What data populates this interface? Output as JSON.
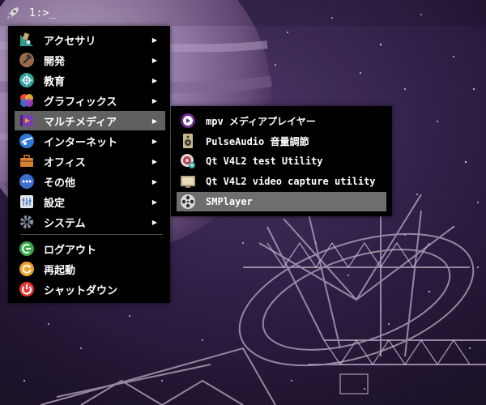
{
  "panel": {
    "launcher_icon": "rocket-icon",
    "terminal_title": "1:>_"
  },
  "menu": {
    "items": [
      {
        "label": "アクセサリ",
        "icon": "accessories-icon",
        "arrow": "▶"
      },
      {
        "label": "開発",
        "icon": "development-icon",
        "arrow": "▶"
      },
      {
        "label": "教育",
        "icon": "education-icon",
        "arrow": "▶"
      },
      {
        "label": "グラフィックス",
        "icon": "graphics-icon",
        "arrow": "▶"
      },
      {
        "label": "マルチメディア",
        "icon": "multimedia-icon",
        "arrow": "▶"
      },
      {
        "label": "インターネット",
        "icon": "internet-icon",
        "arrow": "▶"
      },
      {
        "label": "オフィス",
        "icon": "office-icon",
        "arrow": "▶"
      },
      {
        "label": "その他",
        "icon": "other-icon",
        "arrow": "▶"
      },
      {
        "label": "設定",
        "icon": "settings-icon",
        "arrow": "▶"
      },
      {
        "label": "システム",
        "icon": "system-icon",
        "arrow": "▶"
      }
    ],
    "actions": [
      {
        "label": "ログアウト",
        "icon": "logout-icon"
      },
      {
        "label": "再起動",
        "icon": "reboot-icon"
      },
      {
        "label": "シャットダウン",
        "icon": "shutdown-icon"
      }
    ]
  },
  "submenu": {
    "items": [
      {
        "label": "mpv メディアプレイヤー",
        "icon": "mpv-icon"
      },
      {
        "label": "PulseAudio 音量調節",
        "icon": "speaker-icon"
      },
      {
        "label": "Qt V4L2 test Utility",
        "icon": "webcam-icon"
      },
      {
        "label": "Qt V4L2 video capture utility",
        "icon": "monitor-icon"
      },
      {
        "label": "SMPlayer",
        "icon": "film-reel-icon"
      }
    ]
  },
  "colors": {
    "menu_background": "#000000",
    "menu_highlight": "#606060",
    "submenu_highlight": "#6e6e6e",
    "text": "#ffffff"
  }
}
